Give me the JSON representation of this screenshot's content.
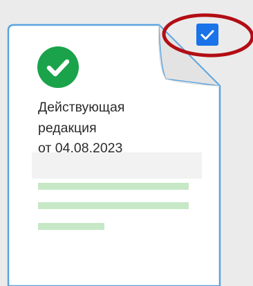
{
  "document": {
    "title_line1": "Действующая",
    "title_line2": "редакция",
    "title_line3": "от 04.08.2023",
    "status_icon": "check-circle-icon",
    "selected": true
  },
  "colors": {
    "page_bg": "#ebebeb",
    "sheet_fill": "#ffffff",
    "sheet_border": "#5ba3e0",
    "status_green": "#1aa34a",
    "checkbox_blue": "#1a73e8",
    "highlight_red": "#b30d14",
    "placeholder_line": "#c6e8c6",
    "placeholder_band": "#f2f2f2"
  }
}
